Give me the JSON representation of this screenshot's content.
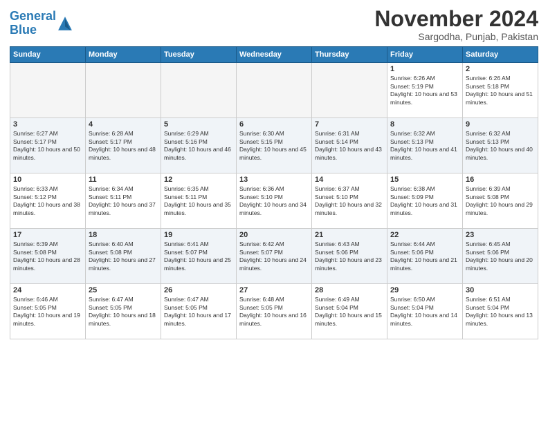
{
  "header": {
    "logo_line1": "General",
    "logo_line2": "Blue",
    "month": "November 2024",
    "location": "Sargodha, Punjab, Pakistan"
  },
  "weekdays": [
    "Sunday",
    "Monday",
    "Tuesday",
    "Wednesday",
    "Thursday",
    "Friday",
    "Saturday"
  ],
  "weeks": [
    [
      {
        "day": "",
        "info": ""
      },
      {
        "day": "",
        "info": ""
      },
      {
        "day": "",
        "info": ""
      },
      {
        "day": "",
        "info": ""
      },
      {
        "day": "",
        "info": ""
      },
      {
        "day": "1",
        "info": "Sunrise: 6:26 AM\nSunset: 5:19 PM\nDaylight: 10 hours and 53 minutes."
      },
      {
        "day": "2",
        "info": "Sunrise: 6:26 AM\nSunset: 5:18 PM\nDaylight: 10 hours and 51 minutes."
      }
    ],
    [
      {
        "day": "3",
        "info": "Sunrise: 6:27 AM\nSunset: 5:17 PM\nDaylight: 10 hours and 50 minutes."
      },
      {
        "day": "4",
        "info": "Sunrise: 6:28 AM\nSunset: 5:17 PM\nDaylight: 10 hours and 48 minutes."
      },
      {
        "day": "5",
        "info": "Sunrise: 6:29 AM\nSunset: 5:16 PM\nDaylight: 10 hours and 46 minutes."
      },
      {
        "day": "6",
        "info": "Sunrise: 6:30 AM\nSunset: 5:15 PM\nDaylight: 10 hours and 45 minutes."
      },
      {
        "day": "7",
        "info": "Sunrise: 6:31 AM\nSunset: 5:14 PM\nDaylight: 10 hours and 43 minutes."
      },
      {
        "day": "8",
        "info": "Sunrise: 6:32 AM\nSunset: 5:13 PM\nDaylight: 10 hours and 41 minutes."
      },
      {
        "day": "9",
        "info": "Sunrise: 6:32 AM\nSunset: 5:13 PM\nDaylight: 10 hours and 40 minutes."
      }
    ],
    [
      {
        "day": "10",
        "info": "Sunrise: 6:33 AM\nSunset: 5:12 PM\nDaylight: 10 hours and 38 minutes."
      },
      {
        "day": "11",
        "info": "Sunrise: 6:34 AM\nSunset: 5:11 PM\nDaylight: 10 hours and 37 minutes."
      },
      {
        "day": "12",
        "info": "Sunrise: 6:35 AM\nSunset: 5:11 PM\nDaylight: 10 hours and 35 minutes."
      },
      {
        "day": "13",
        "info": "Sunrise: 6:36 AM\nSunset: 5:10 PM\nDaylight: 10 hours and 34 minutes."
      },
      {
        "day": "14",
        "info": "Sunrise: 6:37 AM\nSunset: 5:10 PM\nDaylight: 10 hours and 32 minutes."
      },
      {
        "day": "15",
        "info": "Sunrise: 6:38 AM\nSunset: 5:09 PM\nDaylight: 10 hours and 31 minutes."
      },
      {
        "day": "16",
        "info": "Sunrise: 6:39 AM\nSunset: 5:08 PM\nDaylight: 10 hours and 29 minutes."
      }
    ],
    [
      {
        "day": "17",
        "info": "Sunrise: 6:39 AM\nSunset: 5:08 PM\nDaylight: 10 hours and 28 minutes."
      },
      {
        "day": "18",
        "info": "Sunrise: 6:40 AM\nSunset: 5:08 PM\nDaylight: 10 hours and 27 minutes."
      },
      {
        "day": "19",
        "info": "Sunrise: 6:41 AM\nSunset: 5:07 PM\nDaylight: 10 hours and 25 minutes."
      },
      {
        "day": "20",
        "info": "Sunrise: 6:42 AM\nSunset: 5:07 PM\nDaylight: 10 hours and 24 minutes."
      },
      {
        "day": "21",
        "info": "Sunrise: 6:43 AM\nSunset: 5:06 PM\nDaylight: 10 hours and 23 minutes."
      },
      {
        "day": "22",
        "info": "Sunrise: 6:44 AM\nSunset: 5:06 PM\nDaylight: 10 hours and 21 minutes."
      },
      {
        "day": "23",
        "info": "Sunrise: 6:45 AM\nSunset: 5:06 PM\nDaylight: 10 hours and 20 minutes."
      }
    ],
    [
      {
        "day": "24",
        "info": "Sunrise: 6:46 AM\nSunset: 5:05 PM\nDaylight: 10 hours and 19 minutes."
      },
      {
        "day": "25",
        "info": "Sunrise: 6:47 AM\nSunset: 5:05 PM\nDaylight: 10 hours and 18 minutes."
      },
      {
        "day": "26",
        "info": "Sunrise: 6:47 AM\nSunset: 5:05 PM\nDaylight: 10 hours and 17 minutes."
      },
      {
        "day": "27",
        "info": "Sunrise: 6:48 AM\nSunset: 5:05 PM\nDaylight: 10 hours and 16 minutes."
      },
      {
        "day": "28",
        "info": "Sunrise: 6:49 AM\nSunset: 5:04 PM\nDaylight: 10 hours and 15 minutes."
      },
      {
        "day": "29",
        "info": "Sunrise: 6:50 AM\nSunset: 5:04 PM\nDaylight: 10 hours and 14 minutes."
      },
      {
        "day": "30",
        "info": "Sunrise: 6:51 AM\nSunset: 5:04 PM\nDaylight: 10 hours and 13 minutes."
      }
    ]
  ]
}
